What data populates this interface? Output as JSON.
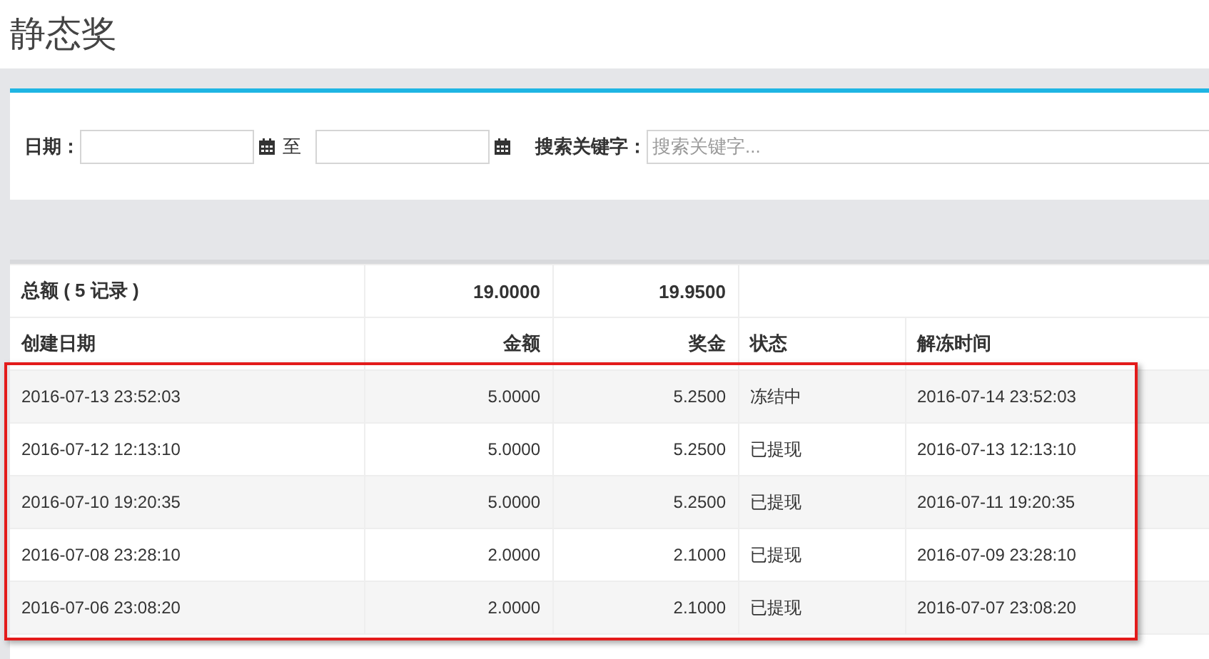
{
  "page_title": "静态奖",
  "filter": {
    "date_label": "日期：",
    "range_separator": "至",
    "keyword_label": "搜索关键字：",
    "keyword": {
      "placeholder": "搜索关键字..."
    }
  },
  "table": {
    "summary": {
      "label": "总额 ( 5 记录 )",
      "amount": "19.0000",
      "bonus": "19.9500"
    },
    "columns": [
      {
        "label": "创建日期",
        "kind": "text"
      },
      {
        "label": "金额",
        "kind": "number"
      },
      {
        "label": "奖金",
        "kind": "number"
      },
      {
        "label": "状态",
        "kind": "text"
      },
      {
        "label": "解冻时间",
        "kind": "text"
      }
    ],
    "rows": [
      [
        "2016-07-13 23:52:03",
        "5.0000",
        "5.2500",
        "冻结中",
        "2016-07-14 23:52:03"
      ],
      [
        "2016-07-12 12:13:10",
        "5.0000",
        "5.2500",
        "已提现",
        "2016-07-13 12:13:10"
      ],
      [
        "2016-07-10 19:20:35",
        "5.0000",
        "5.2500",
        "已提现",
        "2016-07-11 19:20:35"
      ],
      [
        "2016-07-08 23:28:10",
        "2.0000",
        "2.1000",
        "已提现",
        "2016-07-09 23:28:10"
      ],
      [
        "2016-07-06 23:08:20",
        "2.0000",
        "2.1000",
        "已提现",
        "2016-07-07 23:08:20"
      ]
    ]
  }
}
